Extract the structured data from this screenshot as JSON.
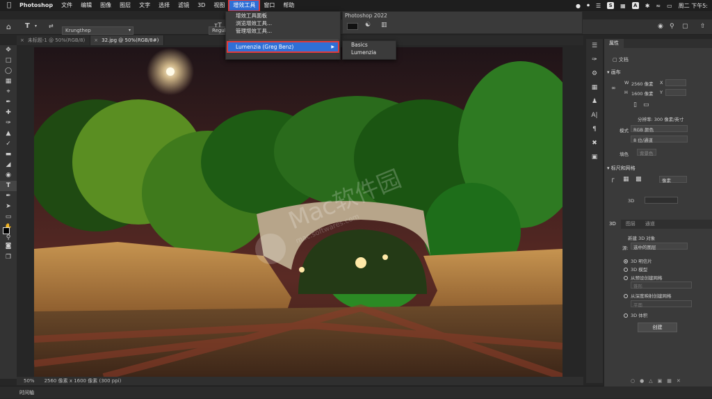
{
  "menubar": {
    "apple": "",
    "app": "Photoshop",
    "items": [
      "文件",
      "编辑",
      "图像",
      "图层",
      "文字",
      "选择",
      "滤镜",
      "3D",
      "视图",
      "增效工具",
      "窗口",
      "帮助"
    ],
    "tray_s": "S",
    "tray_a": "A",
    "clock": "周二 下午5:"
  },
  "plugin_menu": {
    "items": [
      "增效工具面板",
      "浏览增效工具...",
      "管理增效工具..."
    ],
    "highlight": "Lumenzia (Greg Benz)",
    "submenu": [
      "Basics",
      "Lumenzia"
    ]
  },
  "ps_panel": {
    "title": "Photoshop 2022"
  },
  "options": {
    "font": "Krungthep",
    "style": "Regular"
  },
  "tabs": [
    {
      "label": "未标题-1 @ 50%(RGB/8)"
    },
    {
      "label": "32.jpg @ 50%(RGB/8#)"
    }
  ],
  "status": {
    "zoom": "50%",
    "info": "2560 像素 x 1600 像素 (300 ppi)"
  },
  "timeline": {
    "label": "时间轴"
  },
  "props": {
    "tab": "属性",
    "doc": "文档",
    "canvas_title": "画布",
    "w_label": "W",
    "w_value": "2560 像素",
    "x_label": "X",
    "h_label": "H",
    "h_value": "1600 像素",
    "y_label": "Y",
    "resolution": "分辨率: 300 像素/英寸",
    "mode_label": "模式",
    "mode_value": "RGB 颜色",
    "depth_value": "8 位/通道",
    "fill_label": "填色",
    "fill_value": "背景色",
    "ruler_title": "标尺和网格",
    "ruler_unit": "像素",
    "d3_label": "3D"
  },
  "panel3d": {
    "tabs": [
      "3D",
      "图层",
      "通道"
    ],
    "new_obj": "新建 3D 对象",
    "source_label": "源:",
    "source_value": "选中的图层",
    "options": [
      "3D 明信片",
      "3D 模型",
      "从预设创建网格",
      "从深度映射创建网格",
      "3D 体积"
    ],
    "preset_value": "锥形",
    "depth_value": "平面",
    "create": "创建"
  },
  "watermark": {
    "line1": "Mac软件园",
    "line2": "mac.softwares.com"
  },
  "colors": {
    "accent": "#2f6fd6",
    "highlight_border": "#e23b3b"
  }
}
